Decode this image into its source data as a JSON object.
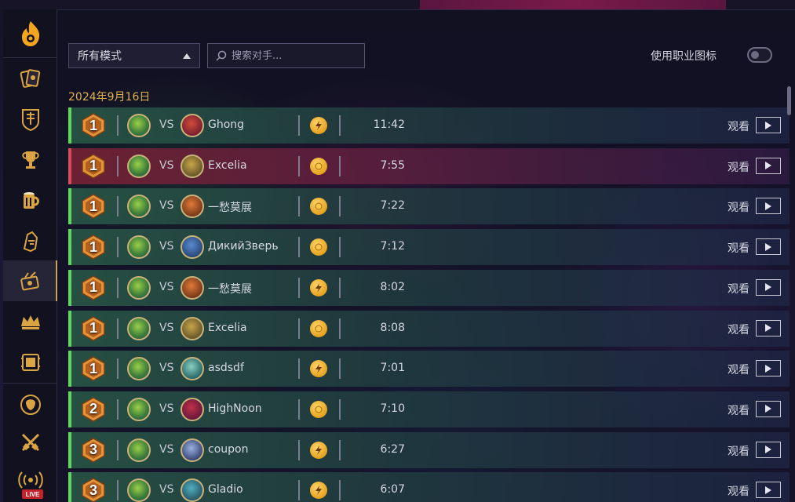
{
  "toolbar": {
    "mode_select": "所有模式",
    "search_placeholder": "搜索对手...",
    "class_icon_toggle_label": "使用职业图标",
    "class_icon_toggle_on": false
  },
  "sidebar": {
    "items": [
      {
        "icon": "hearthstone-logo-icon"
      },
      {
        "icon": "card-collection-icon"
      },
      {
        "icon": "deck-shield-icon"
      },
      {
        "icon": "trophy-icon"
      },
      {
        "icon": "tavern-mug-icon"
      },
      {
        "icon": "hero-helmet-icon"
      },
      {
        "icon": "battlegrounds-replay-icon",
        "active": true
      },
      {
        "icon": "crown-icon"
      },
      {
        "icon": "tavern-board-icon"
      },
      {
        "icon": "lion-emblem-icon"
      },
      {
        "icon": "crossed-swords-icon"
      },
      {
        "icon": "live-broadcast-icon",
        "badge": "LIVE"
      }
    ]
  },
  "colors": {
    "win": "#5cd957",
    "loss": "#d94a5a",
    "date": "#e0b14c",
    "accent": "#c9a54a"
  },
  "date_header": "2024年9月16日",
  "vs_label": "VS",
  "watch_label": "观看",
  "matches": [
    {
      "placement": "1",
      "result": "win",
      "opponent": "Ghong",
      "mode_icon": "bolt",
      "duration": "11:42"
    },
    {
      "placement": "1",
      "result": "loss",
      "opponent": "Excelia",
      "mode_icon": "coin",
      "duration": "7:55"
    },
    {
      "placement": "1",
      "result": "win",
      "opponent": "一愁莫展",
      "mode_icon": "coin",
      "duration": "7:22"
    },
    {
      "placement": "1",
      "result": "win",
      "opponent": "ДикийЗверь",
      "mode_icon": "coin",
      "duration": "7:12"
    },
    {
      "placement": "1",
      "result": "win",
      "opponent": "一愁莫展",
      "mode_icon": "bolt",
      "duration": "8:02"
    },
    {
      "placement": "1",
      "result": "win",
      "opponent": "Excelia",
      "mode_icon": "coin",
      "duration": "8:08"
    },
    {
      "placement": "1",
      "result": "win",
      "opponent": "asdsdf",
      "mode_icon": "bolt",
      "duration": "7:01"
    },
    {
      "placement": "2",
      "result": "win",
      "opponent": "HighNoon",
      "mode_icon": "coin",
      "duration": "7:10"
    },
    {
      "placement": "3",
      "result": "win",
      "opponent": "coupon",
      "mode_icon": "bolt",
      "duration": "6:27"
    },
    {
      "placement": "3",
      "result": "win",
      "opponent": "Gladio",
      "mode_icon": "bolt",
      "duration": "6:07"
    }
  ]
}
